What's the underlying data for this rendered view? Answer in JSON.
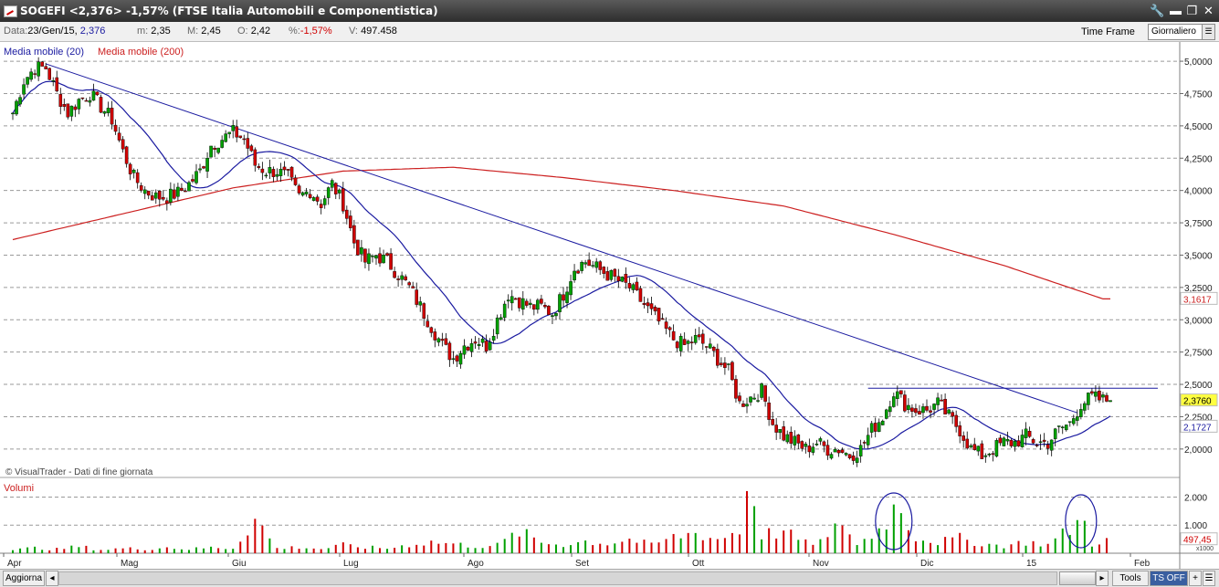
{
  "window": {
    "title": "SOGEFI <2,376> -1,57%  (FTSE Italia Automobili e Componentistica)",
    "buttons": [
      "🔧",
      "▬",
      "❐",
      "✕"
    ]
  },
  "infobar": {
    "date_label": "Data:",
    "date": "23/Gen/15",
    "close_value": "2,376",
    "min_label": "m:",
    "min": "2,35",
    "max_label": "M:",
    "max": "2,45",
    "open_label": "O:",
    "open": "2,42",
    "pct_label": "%:",
    "pct": "-1,57%",
    "vol_label": "V:",
    "vol": "497.458",
    "timeframe_label": "Time Frame",
    "timeframe_value": "Giornaliero"
  },
  "legend": {
    "ma20": "Media mobile (20)",
    "ma200": "Media mobile (200)",
    "copyright": "© VisualTrader - Dati di fine giornata",
    "volume_title": "Volumi"
  },
  "colors": {
    "up": "#00a000",
    "down": "#d00000",
    "ma20": "#1a1aa0",
    "ma200": "#cc2020",
    "highlight_price": "#ffff40"
  },
  "price_axis": {
    "ticks": [
      "5,0000",
      "4,7500",
      "4,5000",
      "4,2500",
      "4,0000",
      "3,7500",
      "3,5000",
      "3,2500",
      "3,0000",
      "2,7500",
      "2,5000",
      "2,2500",
      "2,0000"
    ],
    "tick_values": [
      5.0,
      4.75,
      4.5,
      4.25,
      4.0,
      3.75,
      3.5,
      3.25,
      3.0,
      2.75,
      2.5,
      2.25,
      2.0
    ],
    "labels": [
      {
        "text": "3,1617",
        "value": 3.1617,
        "style": "red"
      },
      {
        "text": "2,3760",
        "value": 2.376,
        "style": "yellow"
      },
      {
        "text": "2,1727",
        "value": 2.1727,
        "style": "blue"
      }
    ]
  },
  "volume_axis": {
    "ticks": [
      "2.000",
      "1.000"
    ],
    "tick_values": [
      2000,
      1000
    ],
    "last_label": "497,45",
    "multiplier": "x1000"
  },
  "time_axis": {
    "labels": [
      "Apr",
      "Mag",
      "Giu",
      "Lug",
      "Ago",
      "Set",
      "Ott",
      "Nov",
      "Dic",
      "15",
      "Feb"
    ]
  },
  "bottombar": {
    "refresh": "Aggiorna",
    "tools": "Tools",
    "ts": "TS OFF"
  },
  "chart_data": {
    "type": "candlestick",
    "title": "SOGEFI <2,376> -1,57%",
    "ylim": [
      1.9,
      5.05
    ],
    "series": [
      {
        "name": "Media mobile (20)"
      },
      {
        "name": "Media mobile (200)"
      },
      {
        "name": "Volumi"
      }
    ],
    "last_close": 2.376,
    "last_ma20": 2.1727,
    "last_ma200": 3.1617,
    "last_volume": 497.458,
    "close_path": [
      [
        0,
        4.6
      ],
      [
        3,
        4.85
      ],
      [
        6,
        4.95
      ],
      [
        9,
        4.95
      ],
      [
        12,
        4.75
      ],
      [
        15,
        4.6
      ],
      [
        18,
        4.7
      ],
      [
        21,
        4.75
      ],
      [
        24,
        4.65
      ],
      [
        27,
        4.55
      ],
      [
        30,
        4.3
      ],
      [
        33,
        4.1
      ],
      [
        36,
        4.0
      ],
      [
        39,
        3.95
      ],
      [
        42,
        3.95
      ],
      [
        45,
        3.98
      ],
      [
        48,
        4.05
      ],
      [
        51,
        4.15
      ],
      [
        54,
        4.35
      ],
      [
        57,
        4.4
      ],
      [
        60,
        4.45
      ],
      [
        63,
        4.4
      ],
      [
        66,
        4.2
      ],
      [
        69,
        4.15
      ],
      [
        72,
        4.15
      ],
      [
        75,
        4.1
      ],
      [
        78,
        3.95
      ],
      [
        81,
        4.0
      ],
      [
        84,
        3.9
      ],
      [
        87,
        4.05
      ],
      [
        90,
        3.9
      ],
      [
        93,
        3.6
      ],
      [
        96,
        3.45
      ],
      [
        99,
        3.5
      ],
      [
        102,
        3.45
      ],
      [
        105,
        3.35
      ],
      [
        108,
        3.25
      ],
      [
        111,
        3.1
      ],
      [
        114,
        2.95
      ],
      [
        117,
        2.8
      ],
      [
        120,
        2.7
      ],
      [
        123,
        2.8
      ],
      [
        126,
        2.85
      ],
      [
        129,
        2.8
      ],
      [
        132,
        3.0
      ],
      [
        135,
        3.2
      ],
      [
        138,
        3.15
      ],
      [
        141,
        3.1
      ],
      [
        144,
        3.1
      ],
      [
        147,
        3.05
      ],
      [
        150,
        3.2
      ],
      [
        153,
        3.4
      ],
      [
        156,
        3.45
      ],
      [
        159,
        3.4
      ],
      [
        162,
        3.35
      ],
      [
        165,
        3.3
      ],
      [
        168,
        3.25
      ],
      [
        171,
        3.15
      ],
      [
        174,
        3.05
      ],
      [
        177,
        2.95
      ],
      [
        180,
        2.85
      ],
      [
        183,
        2.8
      ],
      [
        186,
        2.85
      ],
      [
        189,
        2.8
      ],
      [
        192,
        2.7
      ],
      [
        195,
        2.6
      ],
      [
        198,
        2.35
      ],
      [
        201,
        2.4
      ],
      [
        204,
        2.45
      ],
      [
        207,
        2.2
      ],
      [
        210,
        2.1
      ],
      [
        213,
        2.05
      ],
      [
        216,
        2.0
      ],
      [
        219,
        2.05
      ],
      [
        222,
        2.0
      ],
      [
        225,
        2.0
      ],
      [
        228,
        1.95
      ],
      [
        231,
        2.0
      ],
      [
        234,
        2.15
      ],
      [
        237,
        2.25
      ],
      [
        240,
        2.45
      ],
      [
        243,
        2.35
      ],
      [
        246,
        2.3
      ],
      [
        249,
        2.3
      ],
      [
        252,
        2.35
      ],
      [
        255,
        2.25
      ],
      [
        258,
        2.15
      ],
      [
        261,
        2.0
      ],
      [
        264,
        1.95
      ],
      [
        267,
        2.0
      ],
      [
        270,
        2.05
      ],
      [
        273,
        2.05
      ],
      [
        276,
        2.1
      ],
      [
        279,
        2.05
      ],
      [
        282,
        2.05
      ],
      [
        285,
        2.15
      ],
      [
        288,
        2.2
      ],
      [
        291,
        2.35
      ],
      [
        294,
        2.4
      ],
      [
        297,
        2.376
      ]
    ],
    "volume_path": [
      [
        0,
        120
      ],
      [
        6,
        200
      ],
      [
        12,
        150
      ],
      [
        18,
        250
      ],
      [
        24,
        130
      ],
      [
        30,
        180
      ],
      [
        36,
        160
      ],
      [
        42,
        220
      ],
      [
        48,
        150
      ],
      [
        54,
        210
      ],
      [
        60,
        190
      ],
      [
        66,
        1300
      ],
      [
        72,
        180
      ],
      [
        78,
        230
      ],
      [
        84,
        160
      ],
      [
        90,
        300
      ],
      [
        96,
        220
      ],
      [
        102,
        180
      ],
      [
        108,
        320
      ],
      [
        114,
        420
      ],
      [
        120,
        350
      ],
      [
        126,
        260
      ],
      [
        132,
        300
      ],
      [
        138,
        800
      ],
      [
        144,
        400
      ],
      [
        150,
        320
      ],
      [
        156,
        450
      ],
      [
        162,
        360
      ],
      [
        168,
        520
      ],
      [
        174,
        300
      ],
      [
        180,
        600
      ],
      [
        186,
        760
      ],
      [
        192,
        520
      ],
      [
        198,
        850
      ],
      [
        200,
        2350
      ],
      [
        202,
        2100
      ],
      [
        204,
        700
      ],
      [
        210,
        800
      ],
      [
        216,
        380
      ],
      [
        222,
        500
      ],
      [
        226,
        1250
      ],
      [
        230,
        300
      ],
      [
        236,
        900
      ],
      [
        240,
        1650
      ],
      [
        242,
        1700
      ],
      [
        246,
        600
      ],
      [
        252,
        420
      ],
      [
        258,
        560
      ],
      [
        264,
        350
      ],
      [
        270,
        280
      ],
      [
        276,
        420
      ],
      [
        282,
        320
      ],
      [
        288,
        900
      ],
      [
        290,
        1150
      ],
      [
        292,
        1100
      ],
      [
        294,
        350
      ],
      [
        297,
        497
      ]
    ]
  }
}
